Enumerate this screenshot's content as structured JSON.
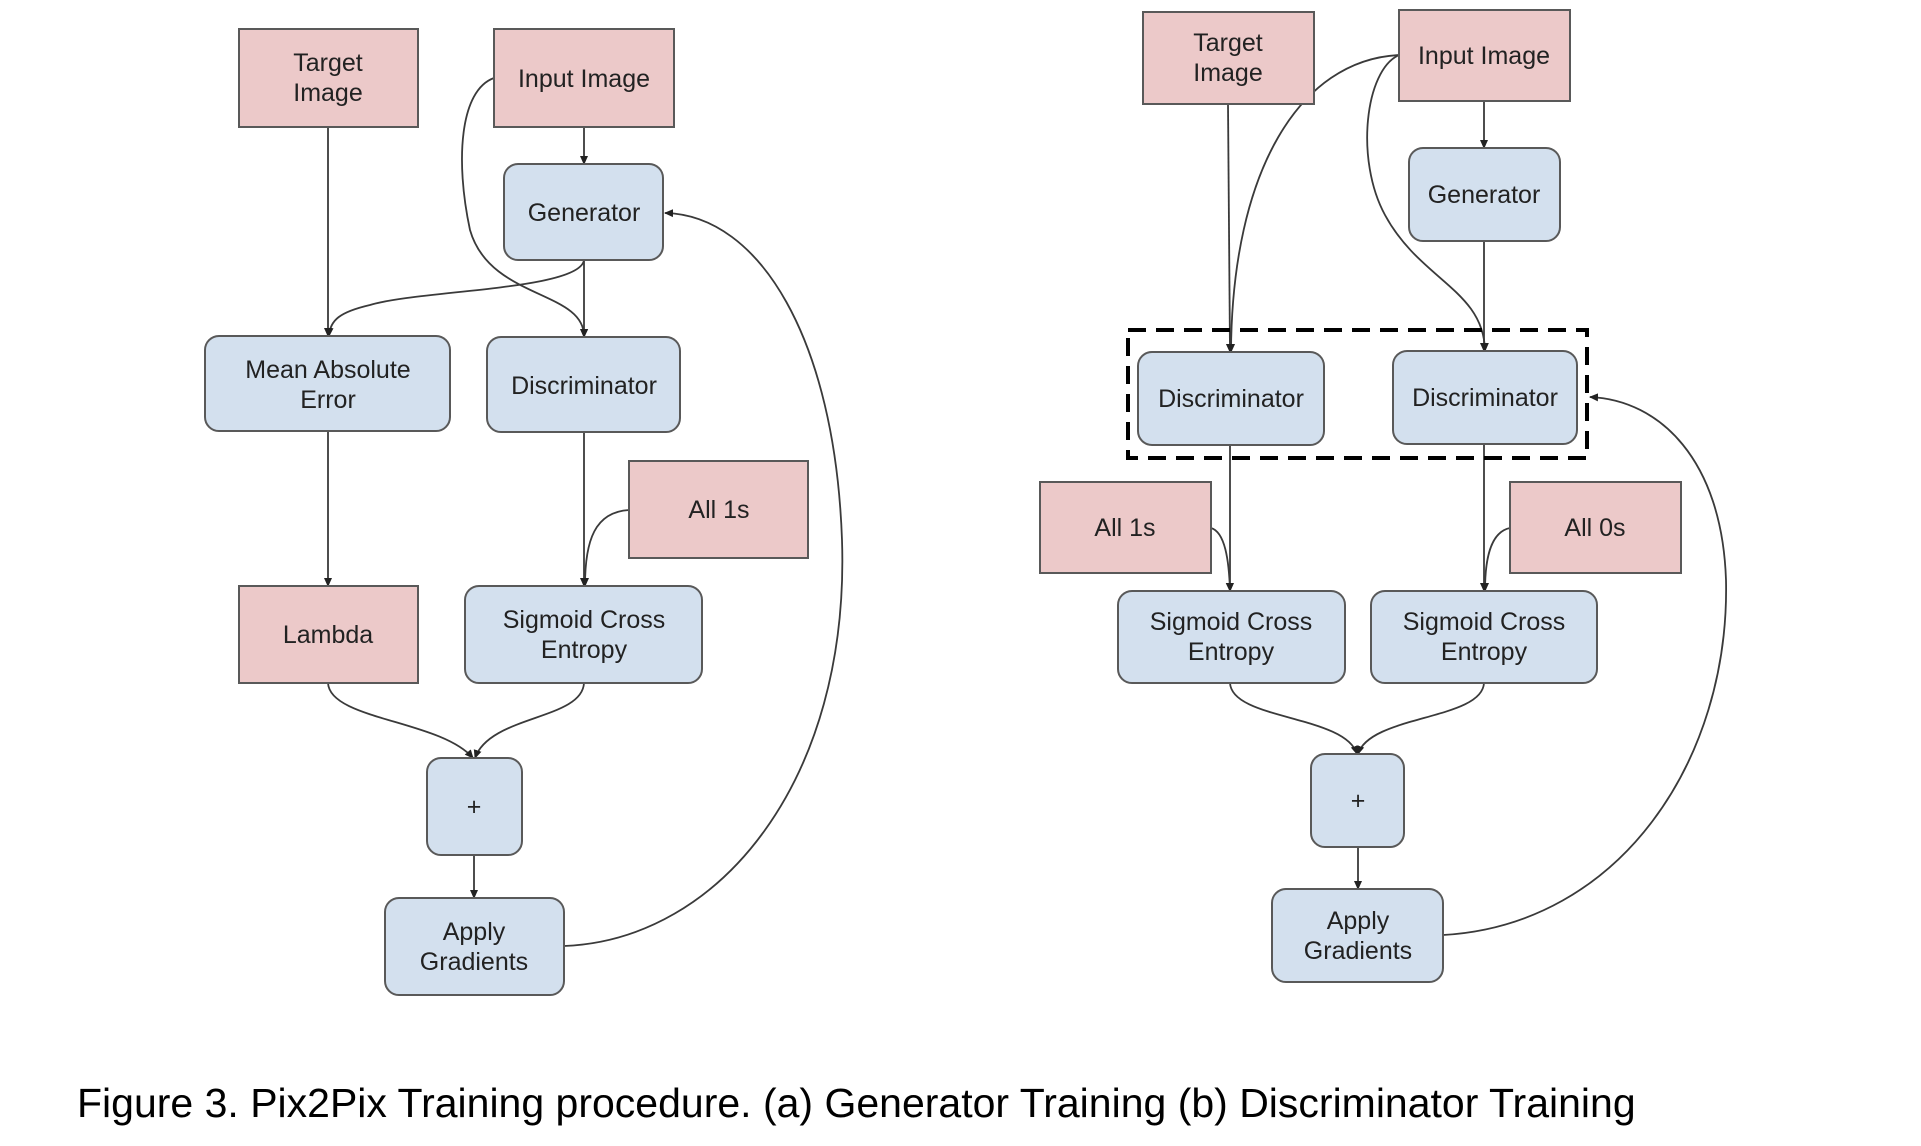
{
  "caption": "Figure 3. Pix2Pix Training procedure. (a) Generator Training (b) Discriminator Training",
  "colors": {
    "input_node": "#ecc9c9",
    "operation_node": "#d3e0ee",
    "border": "#595959",
    "edge": "#3a3a3a"
  },
  "panel_a": {
    "title": "(a) Generator Training",
    "nodes": {
      "target_image": [
        "Target",
        "Image"
      ],
      "input_image": [
        "Input Image"
      ],
      "generator": [
        "Generator"
      ],
      "mean_absolute_error": [
        "Mean Absolute",
        "Error"
      ],
      "discriminator": [
        "Discriminator"
      ],
      "all_1s": [
        "All 1s"
      ],
      "lambda": [
        "Lambda"
      ],
      "sigmoid_cross_entropy": [
        "Sigmoid Cross",
        "Entropy"
      ],
      "plus": [
        "+"
      ],
      "apply_gradients": [
        "Apply",
        "Gradients"
      ]
    },
    "edges": [
      [
        "input_image",
        "generator"
      ],
      [
        "input_image",
        "discriminator"
      ],
      [
        "target_image",
        "mean_absolute_error"
      ],
      [
        "generator",
        "mean_absolute_error"
      ],
      [
        "generator",
        "discriminator"
      ],
      [
        "mean_absolute_error",
        "lambda"
      ],
      [
        "discriminator",
        "sigmoid_cross_entropy"
      ],
      [
        "all_1s",
        "sigmoid_cross_entropy"
      ],
      [
        "lambda",
        "plus"
      ],
      [
        "sigmoid_cross_entropy",
        "plus"
      ],
      [
        "plus",
        "apply_gradients"
      ],
      [
        "apply_gradients",
        "generator"
      ]
    ]
  },
  "panel_b": {
    "title": "(b) Discriminator Training",
    "nodes": {
      "target_image": [
        "Target",
        "Image"
      ],
      "input_image": [
        "Input Image"
      ],
      "generator": [
        "Generator"
      ],
      "discriminator_real": [
        "Discriminator"
      ],
      "discriminator_fake": [
        "Discriminator"
      ],
      "all_1s": [
        "All 1s"
      ],
      "all_0s": [
        "All 0s"
      ],
      "sigmoid_cross_entropy_real": [
        "Sigmoid Cross",
        "Entropy"
      ],
      "sigmoid_cross_entropy_fake": [
        "Sigmoid Cross",
        "Entropy"
      ],
      "plus": [
        "+"
      ],
      "apply_gradients": [
        "Apply",
        "Gradients"
      ]
    },
    "edges": [
      [
        "input_image",
        "generator"
      ],
      [
        "target_image",
        "discriminator_real"
      ],
      [
        "input_image",
        "discriminator_real"
      ],
      [
        "input_image",
        "discriminator_fake"
      ],
      [
        "generator",
        "discriminator_fake"
      ],
      [
        "discriminator_real",
        "sigmoid_cross_entropy_real"
      ],
      [
        "all_1s",
        "sigmoid_cross_entropy_real"
      ],
      [
        "discriminator_fake",
        "sigmoid_cross_entropy_fake"
      ],
      [
        "all_0s",
        "sigmoid_cross_entropy_fake"
      ],
      [
        "sigmoid_cross_entropy_real",
        "plus"
      ],
      [
        "sigmoid_cross_entropy_fake",
        "plus"
      ],
      [
        "plus",
        "apply_gradients"
      ],
      [
        "apply_gradients",
        "discriminator_group"
      ]
    ]
  }
}
